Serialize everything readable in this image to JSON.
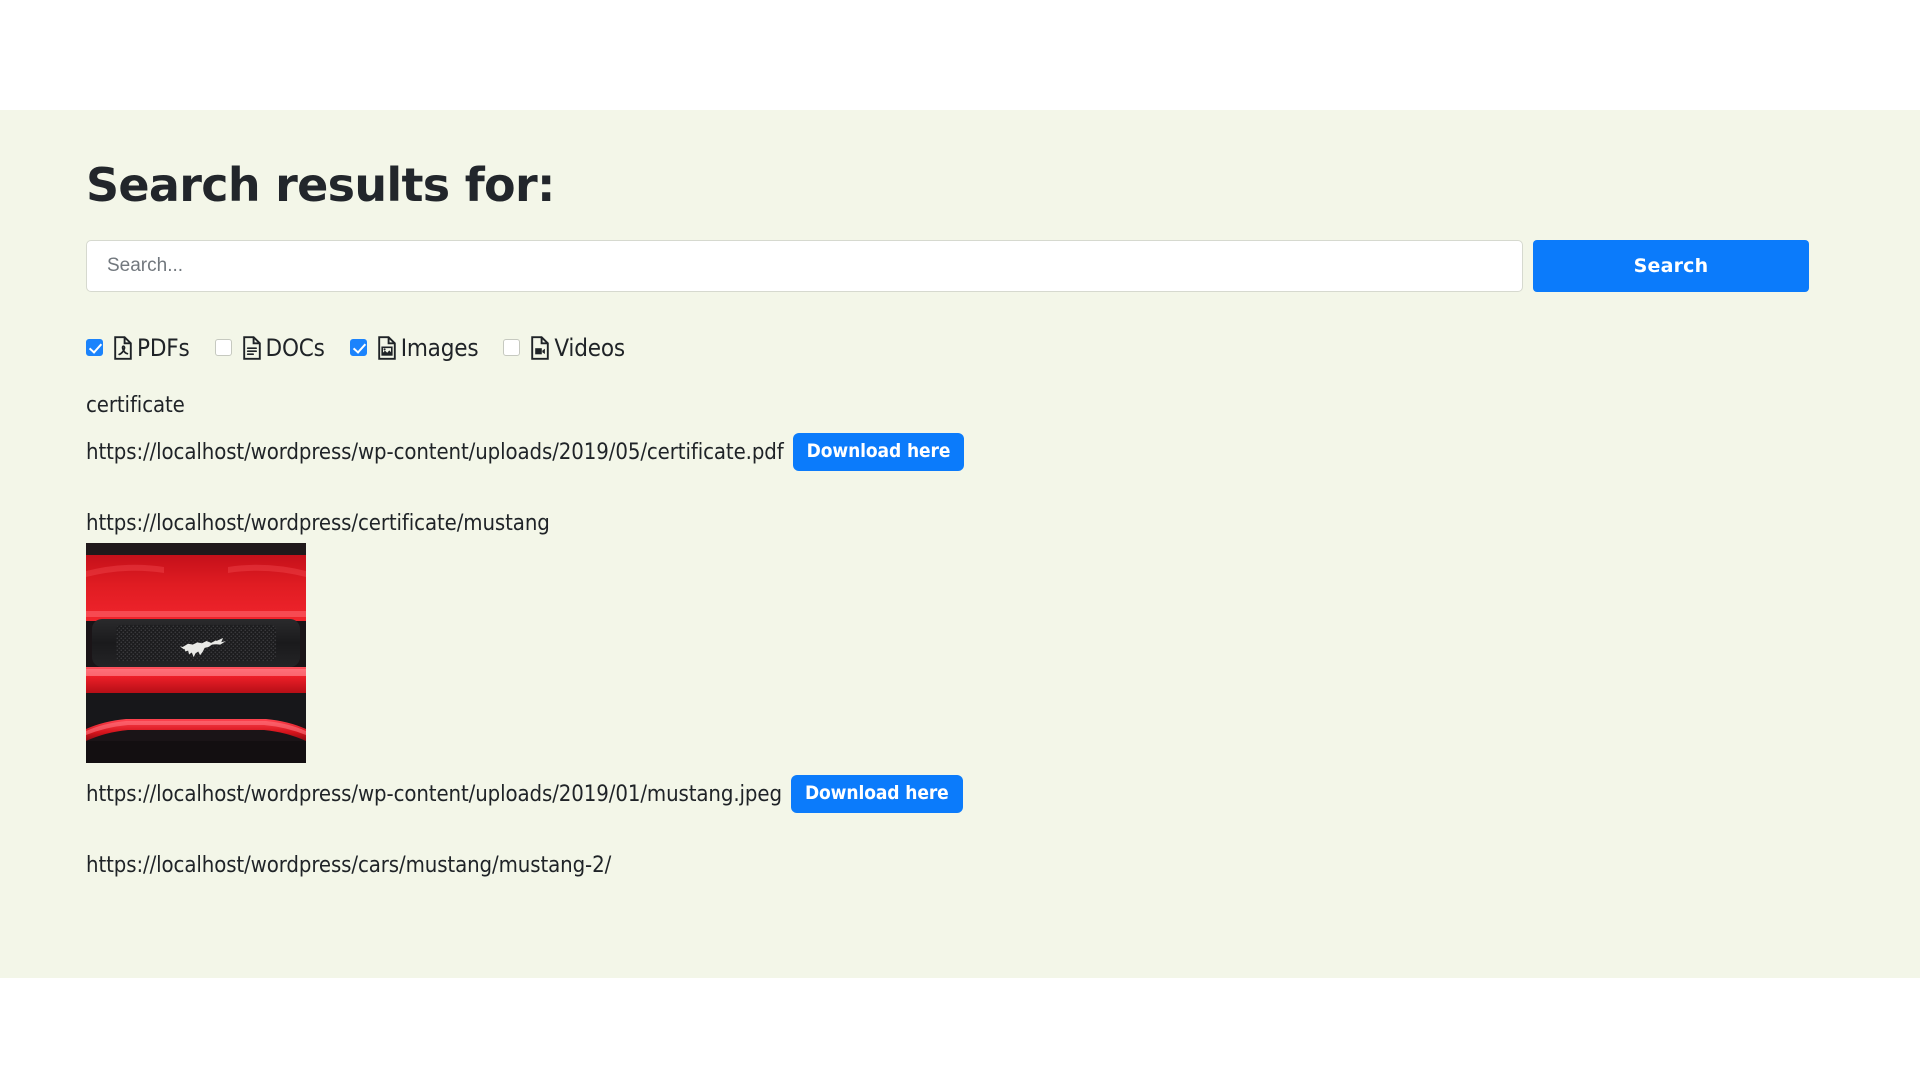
{
  "page": {
    "title": "Search results for:",
    "background_panel_color": "#f3f6e8",
    "accent_color": "#0b7bfb"
  },
  "search": {
    "placeholder": "Search...",
    "value": "",
    "button_label": "Search"
  },
  "filters": [
    {
      "label": "PDFs",
      "checked": true,
      "icon": "pdf-file-icon"
    },
    {
      "label": "DOCs",
      "checked": false,
      "icon": "doc-file-icon"
    },
    {
      "label": "Images",
      "checked": true,
      "icon": "image-file-icon"
    },
    {
      "label": "Videos",
      "checked": false,
      "icon": "video-file-icon"
    }
  ],
  "results": {
    "item1": {
      "title": "certificate",
      "url": "https://localhost/wordpress/wp-content/uploads/2019/05/certificate.pdf",
      "download_label": "Download here"
    },
    "item2": {
      "page_url": "https://localhost/wordpress/certificate/mustang",
      "image_alt": "red-ford-mustang-grille-thumbnail",
      "url": "https://localhost/wordpress/wp-content/uploads/2019/01/mustang.jpeg",
      "download_label": "Download here"
    },
    "item3": {
      "page_url": "https://localhost/wordpress/cars/mustang/mustang-2/"
    }
  }
}
